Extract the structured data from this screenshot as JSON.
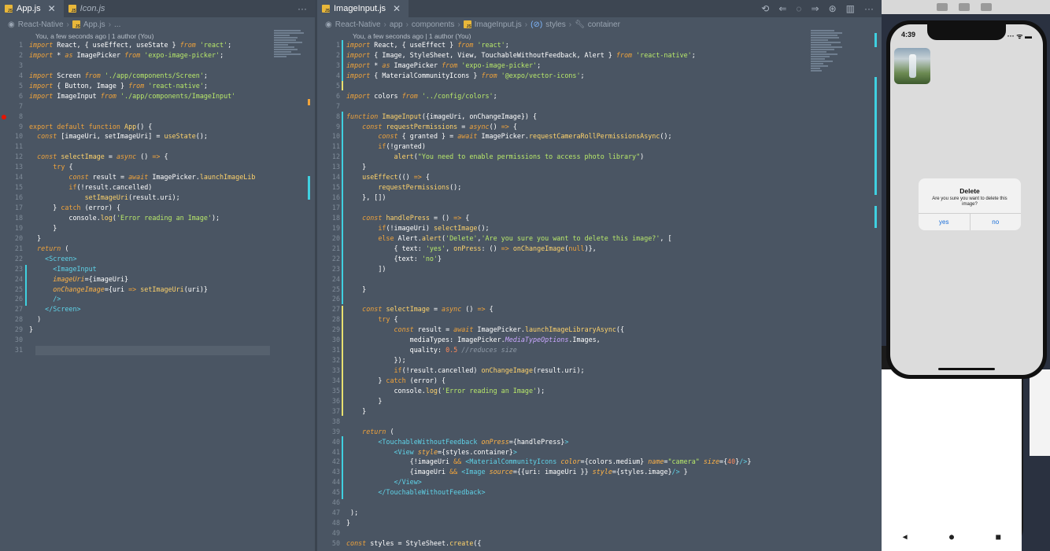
{
  "left_editor": {
    "tabs": [
      {
        "label": "App.js",
        "active": true
      },
      {
        "label": "Icon.js",
        "active": false
      }
    ],
    "more_label": "···",
    "breadcrumb": [
      "React-Native",
      "App.js",
      "..."
    ],
    "blame": "You, a few seconds ago | 1 author (You)",
    "lines": [
      {
        "n": "1",
        "h": "<span class='kw'>import</span> React, { useEffect, useState } <span class='kw'>from</span> <span class='str'>'react'</span>;"
      },
      {
        "n": "2",
        "h": "<span class='kw'>import</span> * <span class='kw'>as</span> ImagePicker <span class='kw'>from</span> <span class='str'>'expo-image-picker'</span>;"
      },
      {
        "n": "3",
        "h": ""
      },
      {
        "n": "4",
        "h": "<span class='kw'>import</span> Screen <span class='kw'>from</span> <span class='str'>'./app/components/Screen'</span>;"
      },
      {
        "n": "5",
        "h": "<span class='kw'>import</span> { Button, Image } <span class='kw'>from</span> <span class='str'>'react-native'</span>;"
      },
      {
        "n": "6",
        "h": "<span class='kw'>import</span> ImageInput <span class='kw'>from</span> <span class='str'>'./app/components/ImageInput'</span>"
      },
      {
        "n": "7",
        "h": ""
      },
      {
        "n": "8",
        "h": ""
      },
      {
        "n": "9",
        "h": "<span class='kb'>export default function</span> <span class='fn'>App</span>() {"
      },
      {
        "n": "10",
        "h": "  <span class='kw'>const</span> [imageUri, setImageUri] = <span class='fn'>useState</span>();"
      },
      {
        "n": "11",
        "h": ""
      },
      {
        "n": "12",
        "h": "  <span class='kw'>const</span> <span class='fn'>selectImage</span> = <span class='kw'>async</span> () <span class='kb'>=&gt;</span> {"
      },
      {
        "n": "13",
        "h": "      <span class='kb'>try</span> {"
      },
      {
        "n": "14",
        "h": "          <span class='kw'>const</span> result = <span class='kw'>await</span> ImagePicker.<span class='fn'>launchImageLib</span>"
      },
      {
        "n": "15",
        "h": "          <span class='kb'>if</span>(!result.cancelled)"
      },
      {
        "n": "16",
        "h": "              <span class='fn'>setImageUri</span>(result.uri);"
      },
      {
        "n": "17",
        "h": "      } <span class='kb'>catch</span> (error) {"
      },
      {
        "n": "18",
        "h": "          console.<span class='fn'>log</span>(<span class='str'>'Error reading an Image'</span>);"
      },
      {
        "n": "19",
        "h": "      }"
      },
      {
        "n": "20",
        "h": "  }"
      },
      {
        "n": "21",
        "h": "  <span class='kw'>return</span> ("
      },
      {
        "n": "22",
        "h": "    <span class='tag'>&lt;Screen&gt;</span>"
      },
      {
        "n": "23",
        "h": "      <span class='tag'>&lt;ImageInput</span>"
      },
      {
        "n": "24",
        "h": "      <span class='attr'>imageUri</span>={imageUri}"
      },
      {
        "n": "25",
        "h": "      <span class='attr'>onChangeImage</span>={uri <span class='kb'>=&gt;</span> <span class='fn'>setImageUri</span>(uri)}"
      },
      {
        "n": "26",
        "h": "      <span class='tag'>/&gt;</span>"
      },
      {
        "n": "27",
        "h": "    <span class='tag'>&lt;/Screen&gt;</span>"
      },
      {
        "n": "28",
        "h": "  )"
      },
      {
        "n": "29",
        "h": "}"
      },
      {
        "n": "30",
        "h": ""
      },
      {
        "n": "31",
        "h": ""
      }
    ]
  },
  "right_editor": {
    "tabs": [
      {
        "label": "ImageInput.js",
        "active": true
      }
    ],
    "breadcrumb": [
      "React-Native",
      "app",
      "components",
      "ImageInput.js",
      "styles",
      "container"
    ],
    "blame": "You, a few seconds ago | 1 author (You)",
    "lines": [
      {
        "n": "1",
        "h": "<span class='kw'>import</span> React, { useEffect } <span class='kw'>from</span> <span class='str'>'react'</span>;"
      },
      {
        "n": "2",
        "h": "<span class='kw'>import</span> { Image, StyleSheet, View, TouchableWithoutFeedback, Alert } <span class='kw'>from</span> <span class='str'>'react-native'</span>;"
      },
      {
        "n": "3",
        "h": "<span class='kw'>import</span> * <span class='kw'>as</span> ImagePicker <span class='kw'>from</span> <span class='str'>'expo-image-picker'</span>;"
      },
      {
        "n": "4",
        "h": "<span class='kw'>import</span> { MaterialCommunityIcons } <span class='kw'>from</span> <span class='str'>'@expo/vector-icons'</span>;"
      },
      {
        "n": "5",
        "h": ""
      },
      {
        "n": "6",
        "h": "<span class='kw'>import</span> colors <span class='kw'>from</span> <span class='str'>'../config/colors'</span>;"
      },
      {
        "n": "7",
        "h": ""
      },
      {
        "n": "8",
        "h": "<span class='kw'>function</span> <span class='fn'>ImageInput</span>({imageUri, onChangeImage}) {"
      },
      {
        "n": "9",
        "h": "    <span class='kw'>const</span> <span class='fn'>requestPermissions</span> = <span class='kw'>async</span>() <span class='kb'>=&gt;</span> {"
      },
      {
        "n": "10",
        "h": "        <span class='kw'>const</span> { granted } = <span class='kw'>await</span> ImagePicker.<span class='fn'>requestCameraRollPermissionsAsync</span>();"
      },
      {
        "n": "11",
        "h": "        <span class='kb'>if</span>(!granted)"
      },
      {
        "n": "12",
        "h": "            <span class='fn'>alert</span>(<span class='str'>\"You need to enable permissions to access photo library\"</span>)"
      },
      {
        "n": "13",
        "h": "    }"
      },
      {
        "n": "14",
        "h": "    <span class='fn'>useEffect</span>(() <span class='kb'>=&gt;</span> {"
      },
      {
        "n": "15",
        "h": "        <span class='fn'>requestPermissions</span>();"
      },
      {
        "n": "16",
        "h": "    }, [])"
      },
      {
        "n": "17",
        "h": ""
      },
      {
        "n": "18",
        "h": "    <span class='kw'>const</span> <span class='fn'>handlePress</span> = () <span class='kb'>=&gt;</span> {"
      },
      {
        "n": "19",
        "h": "        <span class='kb'>if</span>(!imageUri) <span class='fn'>selectImage</span>();"
      },
      {
        "n": "20",
        "h": "        <span class='kb'>else</span> Alert.<span class='fn'>alert</span>(<span class='str'>'Delete'</span>,<span class='str'>'Are you sure you want to delete this image?'</span>, ["
      },
      {
        "n": "21",
        "h": "            { text: <span class='str'>'yes'</span>, <span class='fn'>onPress</span>: () <span class='kb'>=&gt;</span> <span class='fn'>onChangeImage</span>(<span class='kb'>null</span>)},"
      },
      {
        "n": "22",
        "h": "            {text: <span class='str'>'no'</span>}"
      },
      {
        "n": "23",
        "h": "        ])"
      },
      {
        "n": "24",
        "h": ""
      },
      {
        "n": "25",
        "h": "    }"
      },
      {
        "n": "26",
        "h": ""
      },
      {
        "n": "27",
        "h": "    <span class='kw'>const</span> <span class='fn'>selectImage</span> = <span class='kw'>async</span> () <span class='kb'>=&gt;</span> {"
      },
      {
        "n": "28",
        "h": "        <span class='kb'>try</span> {"
      },
      {
        "n": "29",
        "h": "            <span class='kw'>const</span> result = <span class='kw'>await</span> ImagePicker.<span class='fn'>launchImageLibraryAsync</span>({"
      },
      {
        "n": "30",
        "h": "                mediaTypes: ImagePicker.<span class='prop'>MediaTypeOptions</span>.Images,"
      },
      {
        "n": "31",
        "h": "                quality: <span class='num'>0.5</span> <span class='cm'>//reduces size</span>"
      },
      {
        "n": "32",
        "h": "            });"
      },
      {
        "n": "33",
        "h": "            <span class='kb'>if</span>(!result.cancelled) <span class='fn'>onChangeImage</span>(result.uri);"
      },
      {
        "n": "34",
        "h": "        } <span class='kb'>catch</span> (error) {"
      },
      {
        "n": "35",
        "h": "            console.<span class='fn'>log</span>(<span class='str'>'Error reading an Image'</span>);"
      },
      {
        "n": "36",
        "h": "        }"
      },
      {
        "n": "37",
        "h": "    }"
      },
      {
        "n": "38",
        "h": ""
      },
      {
        "n": "39",
        "h": "    <span class='kw'>return</span> ("
      },
      {
        "n": "40",
        "h": "        <span class='tag'>&lt;TouchableWithoutFeedback</span> <span class='attr'>onPress</span>={handlePress}<span class='tag'>&gt;</span>"
      },
      {
        "n": "41",
        "h": "            <span class='tag'>&lt;View</span> <span class='attr'>style</span>={styles.container}<span class='tag'>&gt;</span>"
      },
      {
        "n": "42",
        "h": "                {!imageUri <span class='kb'>&amp;&amp;</span> <span class='tag'>&lt;MaterialCommunityIcons</span> <span class='attr'>color</span>={colors.medium} <span class='attr'>name</span>=<span class='str'>\"camera\"</span> <span class='attr'>size</span>={<span class='num'>40</span>}<span class='tag'>/&gt;</span>}"
      },
      {
        "n": "43",
        "h": "                {imageUri <span class='kb'>&amp;&amp;</span> <span class='tag'>&lt;Image</span> <span class='attr'>source</span>={{uri: imageUri }} <span class='attr'>style</span>={styles.image}<span class='tag'>/&gt;</span> }"
      },
      {
        "n": "44",
        "h": "            <span class='tag'>&lt;/View&gt;</span>"
      },
      {
        "n": "45",
        "h": "        <span class='tag'>&lt;/TouchableWithoutFeedback&gt;</span>"
      },
      {
        "n": "46",
        "h": ""
      },
      {
        "n": "47",
        "h": " );"
      },
      {
        "n": "48",
        "h": "}"
      },
      {
        "n": "49",
        "h": ""
      },
      {
        "n": "50",
        "h": "<span class='kw'>const</span> styles = StyleSheet.<span class='fn'>create</span>({"
      }
    ]
  },
  "phone": {
    "time": "4:39",
    "status_icons": "··· ᯤ ▬",
    "alert": {
      "title": "Delete",
      "message": "Are you sure you want to delete this image?",
      "yes": "yes",
      "no": "no"
    }
  },
  "colors": {
    "editor_bg": "#4a5563",
    "tab_bar": "#3d4652",
    "keyword": "#f0a33b",
    "string": "#b8e86a",
    "tag": "#5fd3e8",
    "ios_button": "#1a6ed8"
  }
}
